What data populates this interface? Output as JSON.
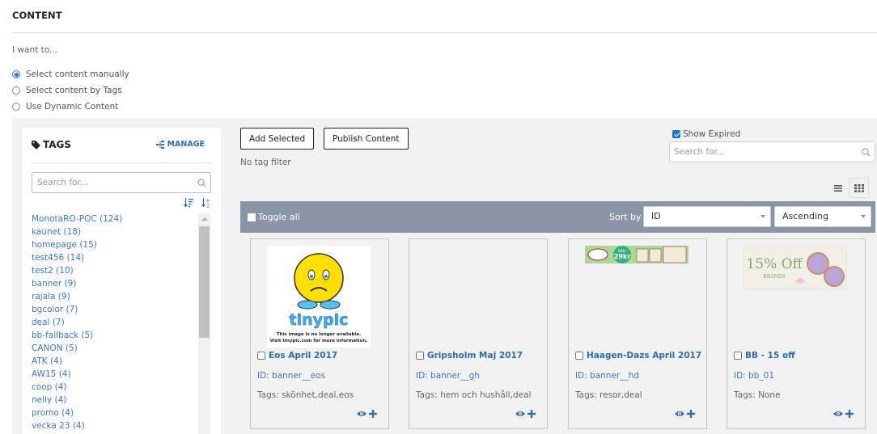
{
  "page": {
    "title": "CONTENT",
    "intro": "I want to...",
    "modes": [
      {
        "label": "Select content manually",
        "checked": true
      },
      {
        "label": "Select content by Tags",
        "checked": false
      },
      {
        "label": "Use Dynamic Content",
        "checked": false
      }
    ]
  },
  "tags": {
    "title": "TAGS",
    "manage_label": "MANAGE",
    "search_placeholder": "Search for...",
    "items": [
      "MonotaRO-POC (124)",
      "kaunet (18)",
      "homepage (15)",
      "test456 (14)",
      "test2 (10)",
      "banner (9)",
      "rajala (9)",
      "bgcolor (7)",
      "deal (7)",
      "bb-fallback (5)",
      "CANON (5)",
      "ATK (4)",
      "AW15 (4)",
      "coop (4)",
      "nelly (4)",
      "promo (4)",
      "vecka 23 (4)"
    ]
  },
  "content": {
    "add_selected_label": "Add Selected",
    "publish_label": "Publish Content",
    "filter_status": "No tag filter",
    "show_expired_label": "Show Expired",
    "show_expired_checked": true,
    "search_placeholder": "Search for...",
    "toggle_all_label": "Toggle all",
    "sort_by_label": "Sort by",
    "sort_field": "ID",
    "sort_order": "Ascending",
    "view_mode": "grid",
    "cards": [
      {
        "title": "Eos April 2017",
        "id": "ID: banner__eos",
        "tags": "Tags: skönhet,deal,eos",
        "image": "tinypic-unavailable"
      },
      {
        "title": "Gripsholm Maj 2017",
        "id": "ID: banner__gh",
        "tags": "Tags: hem och hushåll,deal",
        "image": "none"
      },
      {
        "title": "Haagen-Dazs April 2017",
        "id": "ID: banner__hd",
        "tags": "Tags: resor,deal",
        "image": "haagen-dazs-banner"
      },
      {
        "title": "BB - 15 off",
        "id": "ID: bb_01",
        "tags": "Tags: None",
        "image": "15-off-brands-banner"
      }
    ],
    "tinypic": {
      "brand": "tinypic",
      "line1": "This image is no longer available.",
      "line2": "Visit tinypic.com for more information."
    },
    "hd_banner": {
      "price_old": "56kr",
      "price_new": "29kr"
    },
    "bb_banner": {
      "headline": "15% Off",
      "sub": "BRANDS"
    }
  },
  "colors": {
    "accent": "#2f6db3",
    "link": "#3b78c0",
    "toolbar": "#8a95a5",
    "workspace_bg": "#f2f2f2",
    "radio_checked": "#1a73e8"
  }
}
